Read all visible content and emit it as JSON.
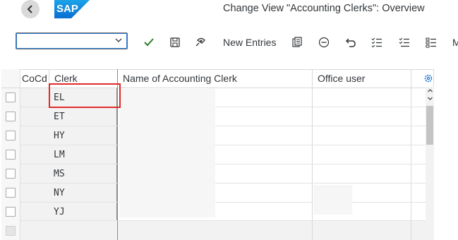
{
  "header": {
    "title": "Change View \"Accounting Clerks\": Overview",
    "logo_text": "SAP"
  },
  "toolbar": {
    "command_field_value": "",
    "new_entries_label": "New Entries",
    "more_label": "M",
    "icons": [
      "check-icon",
      "save-icon",
      "display-change-icon",
      "copy-icon",
      "delete-icon",
      "undo-icon",
      "select-all-icon",
      "select-block-icon",
      "deselect-all-icon"
    ]
  },
  "table": {
    "columns": [
      "CoCd",
      "Clerk",
      "Name of Accounting Clerk",
      "Office user"
    ],
    "rows": [
      {
        "cocd": "",
        "clerk": "EL",
        "name": "",
        "office_user": ""
      },
      {
        "cocd": "",
        "clerk": "ET",
        "name": "",
        "office_user": ""
      },
      {
        "cocd": "",
        "clerk": "HY",
        "name": "",
        "office_user": ""
      },
      {
        "cocd": "",
        "clerk": "LM",
        "name": "",
        "office_user": ""
      },
      {
        "cocd": "",
        "clerk": "MS",
        "name": "",
        "office_user": ""
      },
      {
        "cocd": "",
        "clerk": "NY",
        "name": "",
        "office_user": ""
      },
      {
        "cocd": "",
        "clerk": "YJ",
        "name": "",
        "office_user": ""
      }
    ]
  },
  "colors": {
    "accent": "#2c7ad6",
    "highlight": "#e02a2a",
    "check": "#2b7d2b",
    "logo_blue": "#0a6ed1"
  }
}
